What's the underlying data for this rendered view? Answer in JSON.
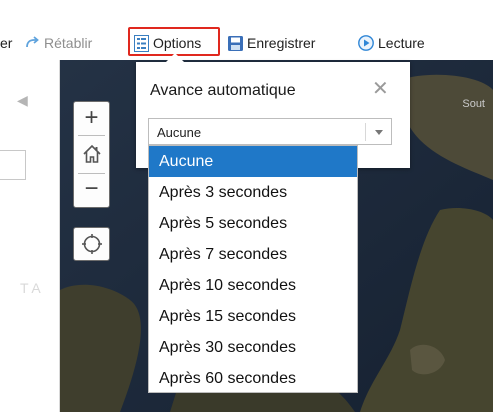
{
  "toolbar": {
    "prev_fragment": "er",
    "redo_label": "Rétablir",
    "options_label": "Options",
    "save_label": "Enregistrer",
    "play_label": "Lecture"
  },
  "left_panel": {
    "faded_text": "T A"
  },
  "map": {
    "label": "Sout"
  },
  "map_controls": {
    "zoom_in": "+",
    "zoom_out": "−"
  },
  "popup": {
    "title": "Avance automatique",
    "close": "✕",
    "select_value": "Aucune",
    "options": [
      "Aucune",
      "Après 3 secondes",
      "Après 5 secondes",
      "Après 7 secondes",
      "Après 10 secondes",
      "Après 15 secondes",
      "Après 30 secondes",
      "Après 60 secondes"
    ],
    "selected_index": 0
  },
  "colors": {
    "accent_blue": "#1f78c8",
    "highlight_red": "#e0281e"
  }
}
